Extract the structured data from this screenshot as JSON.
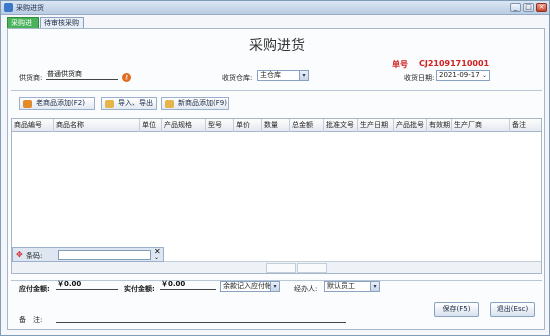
{
  "window": {
    "title": "采购进货",
    "minimize": "_",
    "maximize": "□",
    "close": "×"
  },
  "tabs": [
    {
      "label": "采购进货"
    },
    {
      "label": "待审核采购单"
    }
  ],
  "page_title": "采购进货",
  "order": {
    "label": "单号",
    "number": "CJ21091710001"
  },
  "form": {
    "supplier_label": "供货商:",
    "supplier_value": "普通供货商",
    "warehouse_label": "收货仓库:",
    "warehouse_value": "主仓库",
    "date_label": "收货日期:",
    "date_value": "2021-09-17"
  },
  "toolbar": {
    "old_product": "老商品添加(F2)",
    "import_export": "导入、导出",
    "new_product": "新商品添加(F9)"
  },
  "table": {
    "columns": [
      "商品编号",
      "商品名称",
      "单位",
      "产品规格",
      "型号",
      "单价",
      "数量",
      "总金额",
      "批准文号",
      "生产日期",
      "产品批号",
      "有效期",
      "生产厂商",
      "备注"
    ]
  },
  "barcode": {
    "label": "条码:",
    "close": "✕",
    "chevron": "⌄",
    "icon": "✥"
  },
  "summary": {
    "payable_label": "应付金额:",
    "payable_value": "￥0.00",
    "paid_label": "实付金额:",
    "paid_value": "￥0.00",
    "account_value": "余款记入应付帐",
    "handler_label": "经办人:",
    "handler_value": "默认员工"
  },
  "remark_label": "备　注:",
  "actions": {
    "save": "保存(F5)",
    "exit": "退出(Esc)"
  },
  "colors": {
    "accent": "#49b25a",
    "order_red": "#d02020",
    "border": "#a6b6cb"
  }
}
